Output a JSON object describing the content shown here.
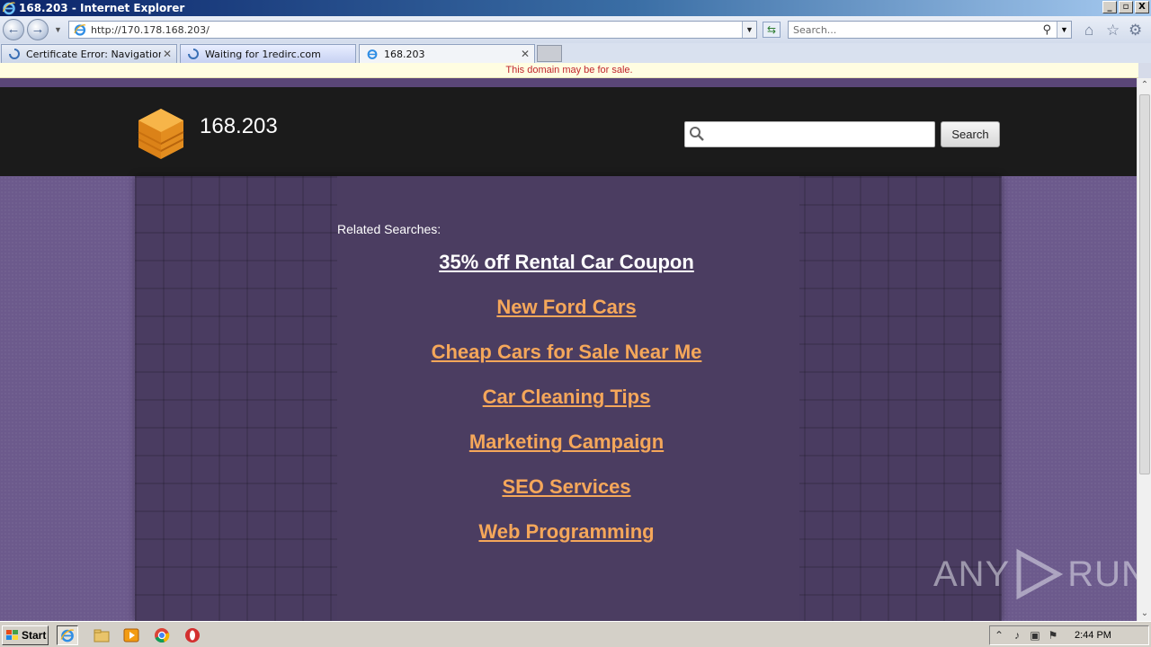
{
  "window": {
    "title": "168.203 - Internet Explorer",
    "buttons": {
      "minimize": "_",
      "maximize": "▫",
      "close": "X"
    }
  },
  "nav": {
    "url": "http://170.178.168.203/",
    "search_placeholder": "Search...",
    "back_icon": "back-arrow-icon",
    "forward_icon": "forward-arrow-icon"
  },
  "tabs": [
    {
      "label": "Certificate Error: Navigation ...",
      "state": "loading"
    },
    {
      "label": "Waiting for 1redirc.com",
      "state": "loading"
    },
    {
      "label": "168.203",
      "state": "active"
    }
  ],
  "infobar": {
    "text": "This domain may be for sale."
  },
  "site": {
    "name": "168.203",
    "search_button": "Search",
    "related_label": "Related Searches:",
    "links": [
      "35% off Rental Car Coupon",
      "New Ford Cars",
      "Cheap Cars for Sale Near Me",
      "Car Cleaning Tips",
      "Marketing Campaign",
      "SEO Services",
      "Web Programming"
    ],
    "colors": {
      "header": "#1b1b1b",
      "panel": "#4a3c61",
      "link": "#f5a75a",
      "visited_link": "#ffffff",
      "background": "#6f5a8f"
    }
  },
  "watermark": {
    "left": "ANY",
    "right": "RUN"
  },
  "taskbar": {
    "start_label": "Start",
    "clock": "2:44 PM"
  }
}
